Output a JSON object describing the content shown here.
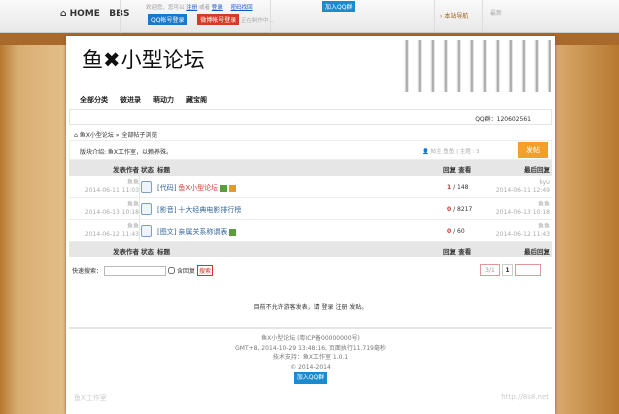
{
  "topbar": {
    "home": "HOME",
    "bbs": "BBS",
    "welcome": "欢迎您，您可以",
    "register": "注册",
    "or": "或者",
    "login": "登录",
    "forgot": "密码找回",
    "qq_login": "QQ帐号登录",
    "weibo_login": "微博帐号登录",
    "making": "正在制作中...",
    "join_qq": "加入QQ群",
    "site_nav": "本站导航",
    "more": "最新"
  },
  "header": {
    "logo": "鱼✖小型论坛",
    "nav": [
      "全部分类",
      "彼进录",
      "萌动力",
      "藏宝阁"
    ],
    "qq_group": "QQ群：120602561"
  },
  "breadcrumb": {
    "forum": "鱼X小型论坛",
    "sep": "»",
    "page": "全部帖子浏览"
  },
  "board": {
    "intro": "版块介绍: 鱼X工作室，以赖养殊。",
    "stats": "帖主 鱼鱼 | 主题 : 3",
    "post_button": "发帖"
  },
  "table": {
    "headers": {
      "author": "发表作者",
      "status": "状态",
      "title": "标题",
      "reply_view": "回复 查看",
      "last": "最后回复"
    },
    "rows": [
      {
        "author": "鱼鱼",
        "date": "2014-06-11 11:03",
        "prefix": "[代码]",
        "title": "鱼X小型论坛",
        "replies": "1",
        "views": "148",
        "last_user": "kyu",
        "last_date": "2014-06-11 12:49",
        "tags": [
          "#5a9e3a",
          "#e59a2a"
        ],
        "color": "#d0423a"
      },
      {
        "author": "鱼鱼",
        "date": "2014-06-13 10:18",
        "prefix": "[影音]",
        "title": "十大经典电影排行榜",
        "replies": "0",
        "views": "8217",
        "last_user": "鱼鱼",
        "last_date": "2014-06-13 10:18",
        "tags": [],
        "color": "#336699"
      },
      {
        "author": "鱼鱼",
        "date": "2014-06-12 11:43",
        "prefix": "[图文]",
        "title": "亲属关系称谓表",
        "replies": "0",
        "views": "60",
        "last_user": "鱼鱼",
        "last_date": "2014-06-12 11:43",
        "tags": [
          "#5a9e3a"
        ],
        "color": "#336699"
      }
    ]
  },
  "search": {
    "label": "快速搜索：",
    "value": "",
    "checkbox": "含回复",
    "button": "搜索"
  },
  "pager": {
    "total": "3/1",
    "current": "1"
  },
  "notice": {
    "text": "目前不允许游客发表，请",
    "login": "登录",
    "register": "注册",
    "post": "发贴。"
  },
  "footer": {
    "line1": "鱼X小型论坛 (粤ICP备00000000号)",
    "line2": "GMT+8, 2014-10-29 13:48:16, 页面执行11.719毫秒",
    "line3": "技术支持：鱼X工作室 1.0.1",
    "line4": "© 2014-2014",
    "join_qq": "加入QQ群",
    "left_mark": "鱼X工作室",
    "right_mark": "http://8s8.net"
  }
}
